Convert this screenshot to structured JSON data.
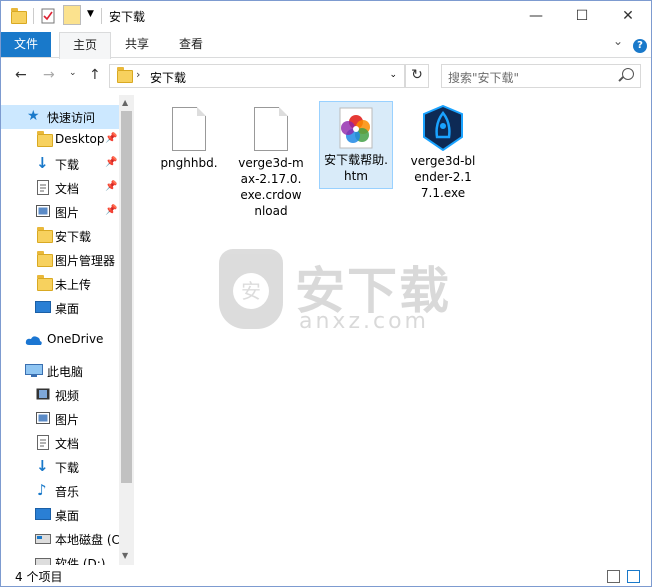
{
  "window": {
    "title": "安下载",
    "controls": {
      "minimize": "—",
      "maximize": "☐",
      "close": "✕"
    }
  },
  "ribbon": {
    "tabs": [
      {
        "label": "文件"
      },
      {
        "label": "主页"
      },
      {
        "label": "共享"
      },
      {
        "label": "查看"
      }
    ],
    "expand_glyph": "⌄",
    "help_glyph": "?"
  },
  "address": {
    "path": "安下载",
    "search_placeholder": "搜索\"安下载\""
  },
  "nav": {
    "quick_access": "快速访问",
    "items": [
      {
        "label": "Desktop",
        "icon": "folder-icon",
        "pinned": true
      },
      {
        "label": "下载",
        "icon": "download-icon",
        "pinned": true
      },
      {
        "label": "文档",
        "icon": "document-icon",
        "pinned": true
      },
      {
        "label": "图片",
        "icon": "picture-icon",
        "pinned": true
      },
      {
        "label": "安下载",
        "icon": "folder-icon",
        "pinned": false
      },
      {
        "label": "图片管理器",
        "icon": "folder-icon",
        "pinned": false
      },
      {
        "label": "未上传",
        "icon": "folder-icon",
        "pinned": false
      },
      {
        "label": "桌面",
        "icon": "desktop-icon",
        "pinned": false
      }
    ],
    "onedrive": "OneDrive",
    "this_pc": "此电脑",
    "pc_items": [
      {
        "label": "视频",
        "icon": "video-icon"
      },
      {
        "label": "图片",
        "icon": "picture-icon"
      },
      {
        "label": "文档",
        "icon": "document-icon"
      },
      {
        "label": "下载",
        "icon": "download-icon"
      },
      {
        "label": "音乐",
        "icon": "music-icon"
      },
      {
        "label": "桌面",
        "icon": "desktop-icon"
      },
      {
        "label": "本地磁盘 (C",
        "icon": "drive-icon"
      },
      {
        "label": "软件 (D:)",
        "icon": "drive-icon"
      }
    ]
  },
  "files": [
    {
      "name": "pnghhbd.",
      "icon": "blank-file-icon",
      "selected": false
    },
    {
      "name": "verge3d-max-2.17.0.exe.crdownload",
      "icon": "blank-file-icon",
      "selected": false
    },
    {
      "name": "安下载帮助.htm",
      "icon": "photos-app-icon",
      "selected": true
    },
    {
      "name": "verge3d-blender-2.17.1.exe",
      "icon": "verge3d-app-icon",
      "selected": false
    }
  ],
  "watermark": {
    "title": "安下载",
    "domain": "anxz.com",
    "badge": "安"
  },
  "status": {
    "item_count": "4 个项目"
  },
  "colors": {
    "accent": "#1979ca",
    "selection": "#cce8ff",
    "folder": "#f7d15e"
  }
}
